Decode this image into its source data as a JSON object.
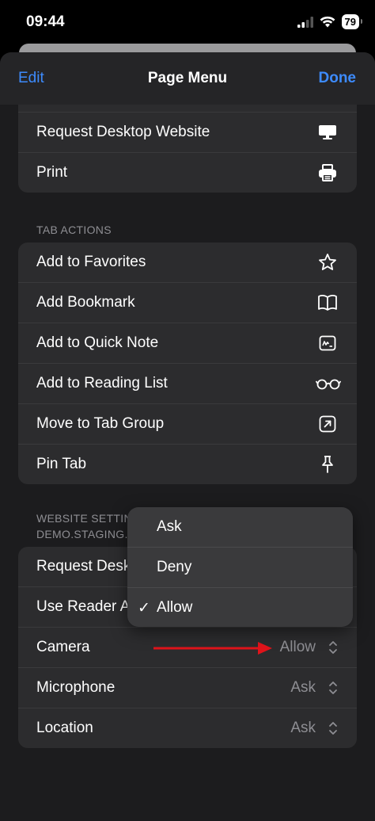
{
  "status": {
    "time": "09:44",
    "battery": "79"
  },
  "nav": {
    "edit": "Edit",
    "title": "Page Menu",
    "done": "Done"
  },
  "top_group": [
    {
      "label": "Request Desktop Website",
      "icon": "desktop-icon"
    },
    {
      "label": "Print",
      "icon": "printer-icon"
    }
  ],
  "tab_actions": {
    "header": "TAB ACTIONS",
    "items": [
      {
        "label": "Add to Favorites",
        "icon": "star-icon"
      },
      {
        "label": "Add Bookmark",
        "icon": "book-icon"
      },
      {
        "label": "Add to Quick Note",
        "icon": "quick-note-icon"
      },
      {
        "label": "Add to Reading List",
        "icon": "glasses-icon"
      },
      {
        "label": "Move to Tab Group",
        "icon": "arrow-up-right-box-icon"
      },
      {
        "label": "Pin Tab",
        "icon": "pin-icon"
      }
    ]
  },
  "website_settings": {
    "header_line1": "WEBSITE SETTIN",
    "header_line2": "DEMO.STAGING.",
    "items": [
      {
        "label": "Request Desk"
      },
      {
        "label": "Use Reader A"
      },
      {
        "label": "Camera",
        "value": "Allow"
      },
      {
        "label": "Microphone",
        "value": "Ask"
      },
      {
        "label": "Location",
        "value": "Ask"
      }
    ]
  },
  "popup": {
    "options": [
      "Ask",
      "Deny",
      "Allow"
    ],
    "selected": "Allow",
    "check_glyph": "✓"
  },
  "colors": {
    "accent": "#3d8bfd",
    "arrow": "#e0141b",
    "background": "#1c1c1e",
    "row_bg": "#2c2c2e"
  }
}
